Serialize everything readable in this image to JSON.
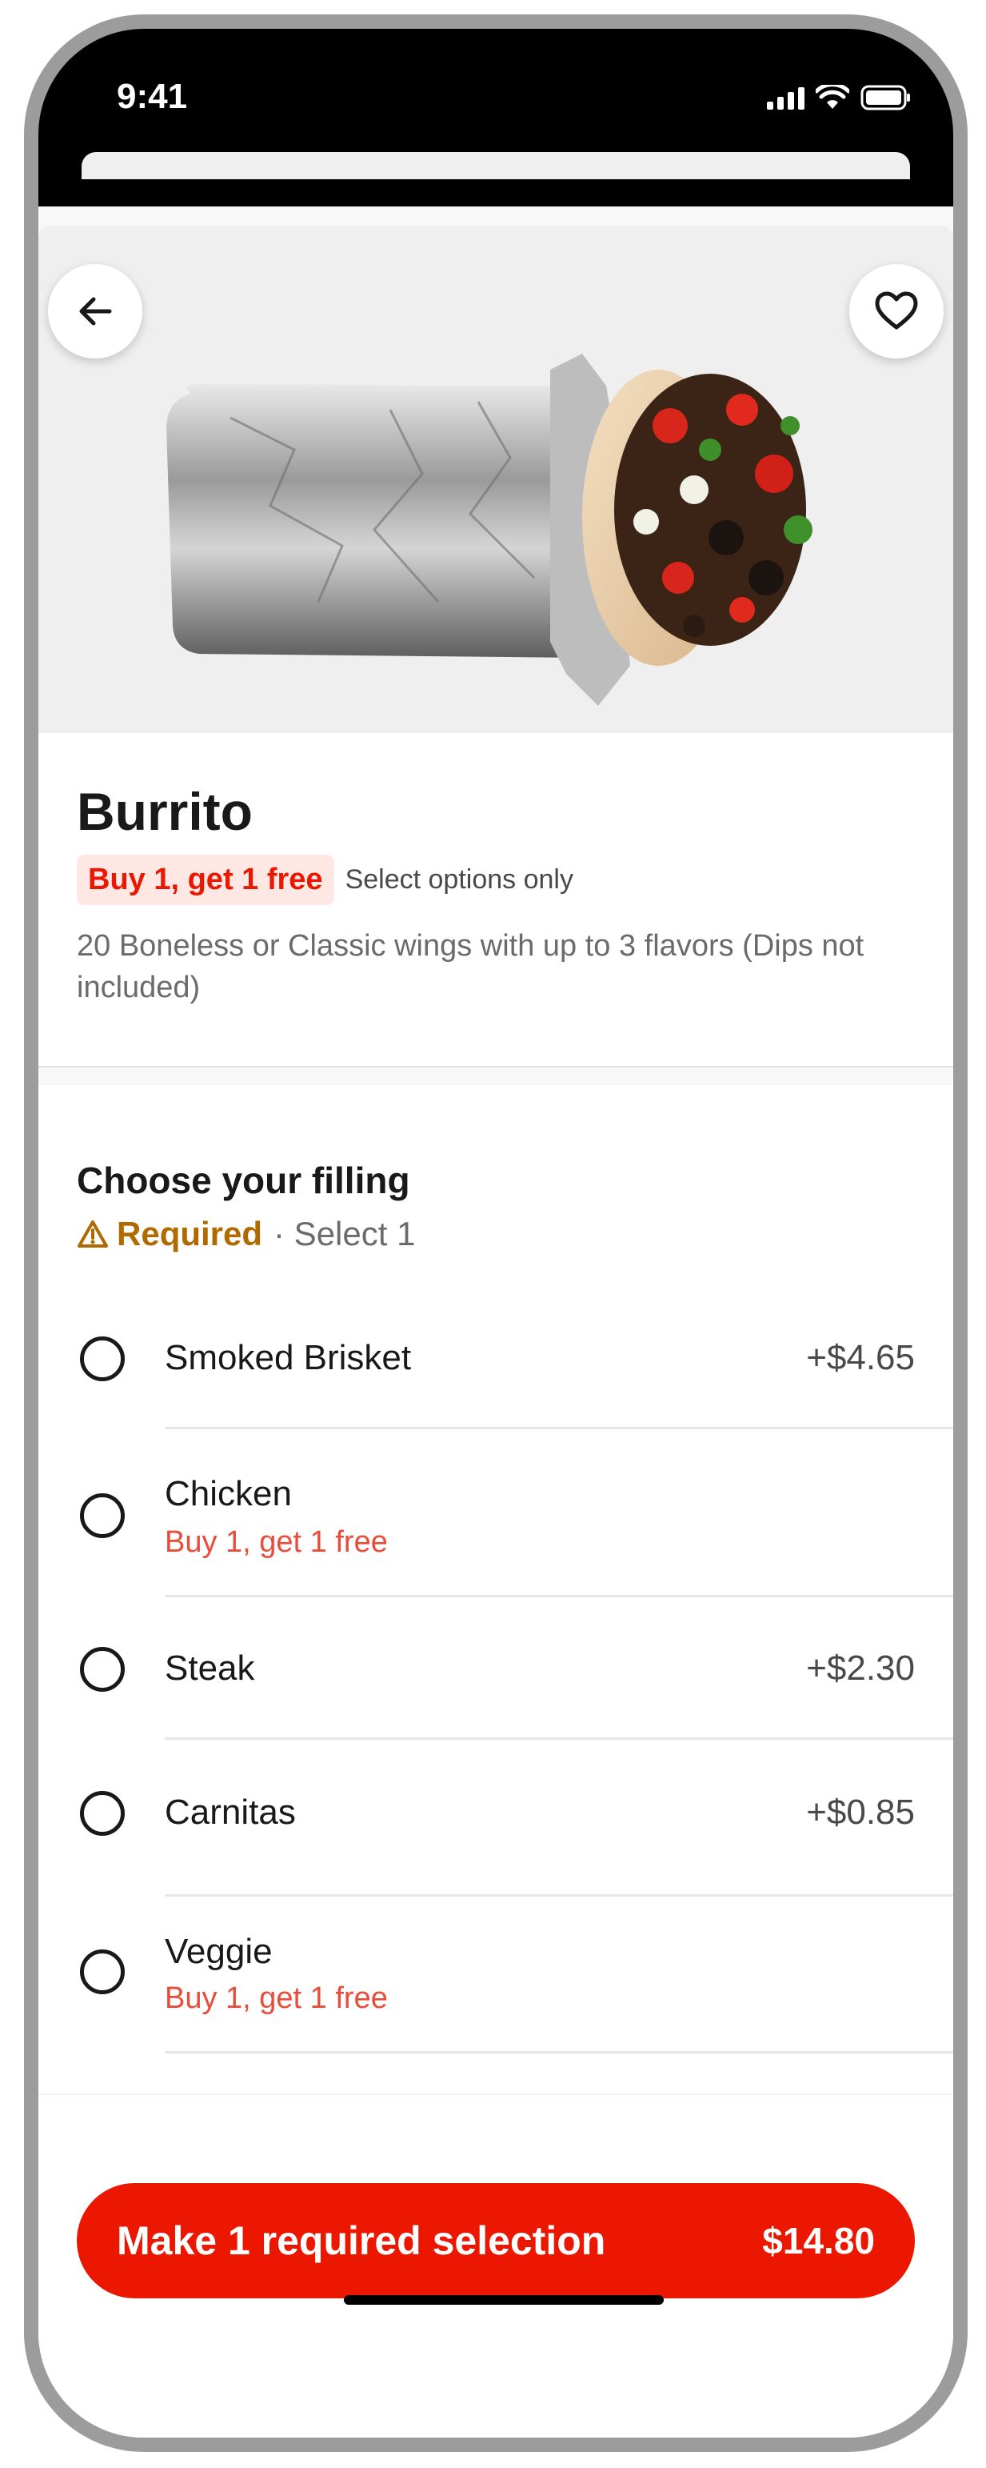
{
  "status_bar": {
    "time": "9:41"
  },
  "product": {
    "title": "Burrito",
    "promo_badge": "Buy 1, get 1 free",
    "promo_note": "Select options only",
    "description": "20 Boneless or Classic wings with up to 3 flavors (Dips not included)"
  },
  "section": {
    "title": "Choose your filling",
    "required_label": "Required",
    "select_text": "· Select 1"
  },
  "options": [
    {
      "name": "Smoked Brisket",
      "price": "+$4.65",
      "promo": ""
    },
    {
      "name": "Chicken",
      "price": "",
      "promo": "Buy 1, get 1 free"
    },
    {
      "name": "Steak",
      "price": "+$2.30",
      "promo": ""
    },
    {
      "name": "Carnitas",
      "price": "+$0.85",
      "promo": ""
    },
    {
      "name": "Veggie",
      "price": "",
      "promo": "Buy 1, get 1 free"
    }
  ],
  "cta": {
    "label": "Make 1 required selection",
    "price": "$14.80"
  },
  "colors": {
    "brand": "#eb1700",
    "required": "#b06a00",
    "promo_text": "#eb4c3a"
  },
  "icons": {
    "back": "arrow-left-icon",
    "favorite": "heart-icon",
    "warning": "warning-triangle-icon"
  }
}
